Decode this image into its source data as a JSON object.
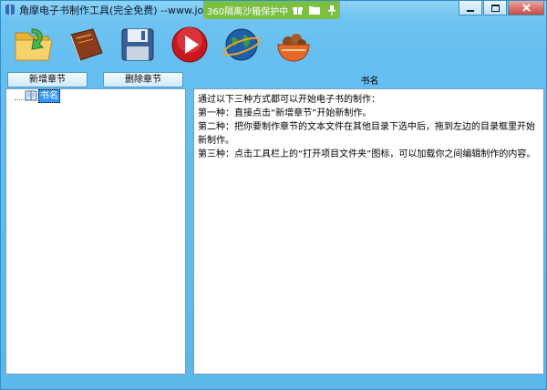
{
  "window": {
    "title": "角摩电子书制作工具(完全免费) --www.joymo.cc"
  },
  "sandbox": {
    "text": "360隔离沙箱保护中..."
  },
  "toolbar": {
    "items": [
      {
        "name": "open-project-folder",
        "icon": "folder-arrow-icon"
      },
      {
        "name": "book",
        "icon": "book-icon"
      },
      {
        "name": "save",
        "icon": "floppy-disk-icon"
      },
      {
        "name": "play",
        "icon": "play-icon"
      },
      {
        "name": "globe",
        "icon": "globe-icon"
      },
      {
        "name": "bowl",
        "icon": "bowl-icon"
      }
    ]
  },
  "buttons": {
    "add_chapter": "新增章节",
    "delete_chapter": "删除章节"
  },
  "content": {
    "header": "书名",
    "lines": [
      "通过以下三种方式都可以开始电子书的制作：",
      "第一种：直接点击“新增章节”开始新制作。",
      "第二种：把你要制作章节的文本文件在其他目录下选中后，拖到左边的目录框里开始新制作。",
      "第三种：点击工具栏上的“打开项目文件夹”图标，可以加载你之间编辑制作的内容。"
    ]
  },
  "tree": {
    "root_label": "书名"
  },
  "colors": {
    "window_bg": "#6cc4f2",
    "sandbox_green": "#7bc043",
    "selected": "#3399ff"
  }
}
